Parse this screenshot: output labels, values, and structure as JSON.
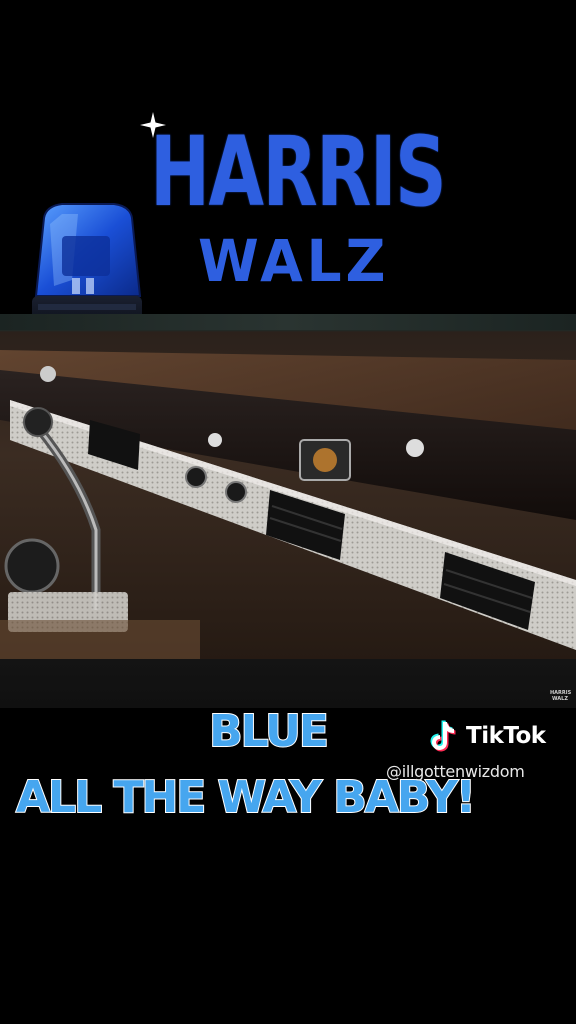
{
  "logo": {
    "line1": "HARRIS",
    "line2": "WALZ",
    "color": "#2e5fe0",
    "icons": [
      "sparkle-icon",
      "siren-light-icon"
    ]
  },
  "video": {
    "watermark_line1": "HARRIS",
    "watermark_line2": "WALZ"
  },
  "captions": {
    "line1": "BLUE",
    "line2": "ALL THE WAY BABY!",
    "fill_color": "#46a6ef",
    "outline_color": "#ffffff"
  },
  "tiktok": {
    "brand": "TikTok",
    "handle": "@illgottenwizdom",
    "icon": "tiktok-logo-icon"
  }
}
